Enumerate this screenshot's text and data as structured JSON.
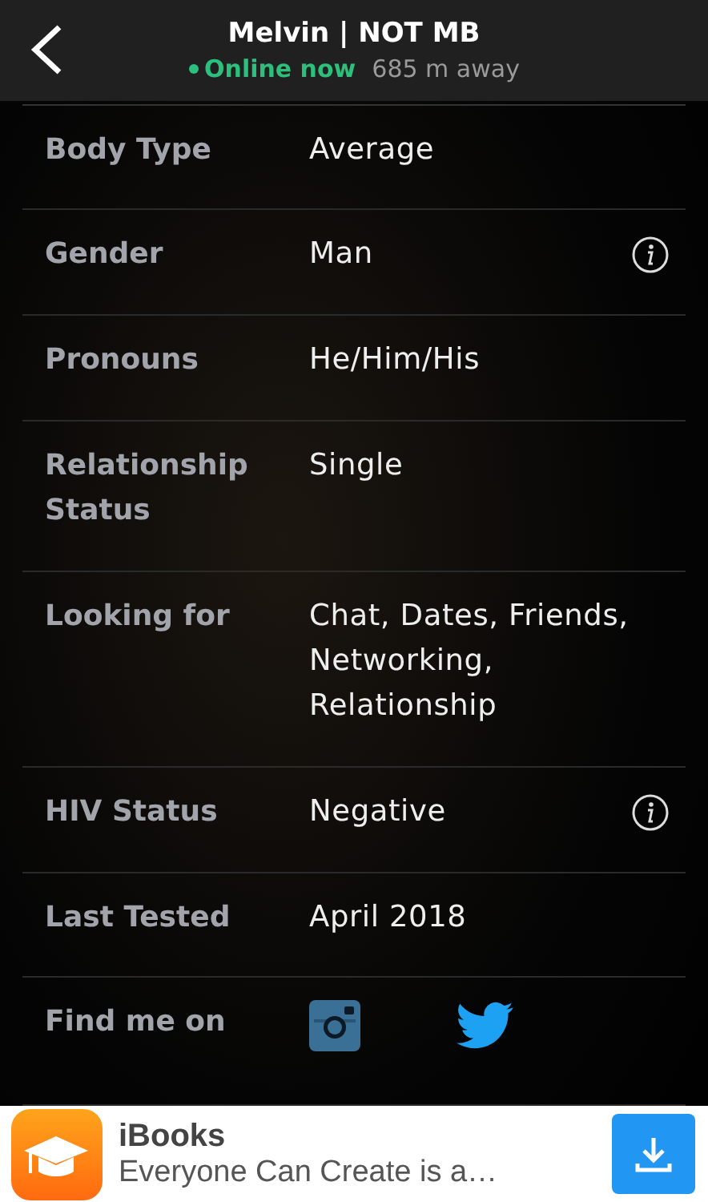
{
  "header": {
    "title": "Melvin | NOT MB",
    "status": "Online now",
    "distance": "685 m away"
  },
  "rows": [
    {
      "kind": "text",
      "label": "Body Type",
      "value": "Average",
      "info": false
    },
    {
      "kind": "text",
      "label": "Gender",
      "value": "Man",
      "info": true
    },
    {
      "kind": "text",
      "label": "Pronouns",
      "value": "He/Him/His",
      "info": false
    },
    {
      "kind": "text",
      "label": "Relationship Status",
      "value": "Single",
      "info": false
    },
    {
      "kind": "text",
      "label": "Looking for",
      "value": "Chat, Dates, Friends, Networking, Relationship",
      "info": false
    },
    {
      "kind": "text",
      "label": "HIV Status",
      "value": "Negative",
      "info": true
    },
    {
      "kind": "text",
      "label": "Last Tested",
      "value": "April 2018",
      "info": false
    },
    {
      "kind": "social",
      "label": "Find me on"
    }
  ],
  "ad": {
    "title": "iBooks",
    "subtitle": "Everyone Can Create is a…"
  }
}
